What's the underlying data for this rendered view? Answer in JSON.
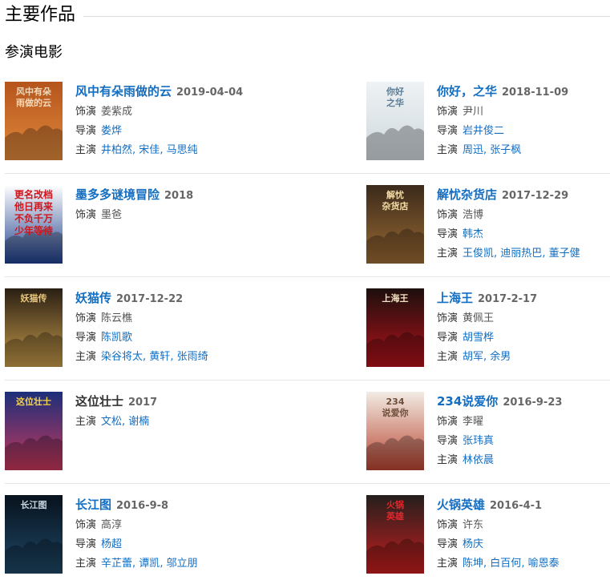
{
  "section": {
    "title": "主要作品"
  },
  "subsection": {
    "title": "参演电影"
  },
  "labels": {
    "role": "饰演",
    "director": "导演",
    "cast": "主演",
    "comma": ", "
  },
  "films": [
    {
      "title": "风中有朵雨做的云",
      "title_link": true,
      "date": "2019-04-04",
      "role": "姜紫成",
      "directors": [
        "娄烨"
      ],
      "cast": [
        "井柏然",
        "宋佳",
        "马思纯"
      ],
      "poster": {
        "bg": "#b5541c",
        "bg2": "#e08a3c",
        "text": "风中有朵\n雨做的云",
        "text_color": "#f3d9b8",
        "icon": "poster-rain-cloud-icon"
      }
    },
    {
      "title": "你好，之华",
      "title_link": true,
      "date": "2018-11-09",
      "role": "尹川",
      "directors": [
        "岩井俊二"
      ],
      "cast": [
        "周迅",
        "张子枫"
      ],
      "poster": {
        "bg": "#eef2f4",
        "bg2": "#cfd8de",
        "text": "你好\n之华",
        "text_color": "#5b7c95",
        "icon": "poster-cast-collage-icon"
      }
    },
    {
      "title": "墨多多谜境冒险",
      "title_link": true,
      "date": "2018",
      "role": "墨爸",
      "directors": [],
      "cast": [],
      "poster": {
        "bg": "#ffffff",
        "bg2": "#1e3f8c",
        "text": "更名改档\n他日再来\n不负千万\n少年等待",
        "text_color": "#d0161b",
        "icon": "poster-text-notice-icon"
      }
    },
    {
      "title": "解忧杂货店",
      "title_link": true,
      "date": "2017-12-29",
      "role": "浩博",
      "directors": [
        "韩杰"
      ],
      "cast": [
        "王俊凯",
        "迪丽热巴",
        "董子健"
      ],
      "poster": {
        "bg": "#3b2a1b",
        "bg2": "#9a6a34",
        "text": "解忧\n杂货店",
        "text_color": "#f2dca4",
        "icon": "poster-grocery-store-icon"
      }
    },
    {
      "title": "妖猫传",
      "title_link": true,
      "date": "2017-12-22",
      "role": "陈云樵",
      "directors": [
        "陈凯歌"
      ],
      "cast": [
        "染谷将太",
        "黄轩",
        "张雨绮"
      ],
      "poster": {
        "bg": "#2a1f14",
        "bg2": "#c49a4a",
        "text": "妖猫传",
        "text_color": "#e8c77a",
        "icon": "poster-cat-legend-icon"
      }
    },
    {
      "title": "上海王",
      "title_link": true,
      "date": "2017-2-17",
      "role": "黄佩王",
      "directors": [
        "胡雪桦"
      ],
      "cast": [
        "胡军",
        "余男"
      ],
      "poster": {
        "bg": "#1c0f0d",
        "bg2": "#b3121b",
        "text": "上海王",
        "text_color": "#f2e3c2",
        "icon": "poster-shanghai-king-icon"
      }
    },
    {
      "title": "这位壮士",
      "title_link": false,
      "date": "2017",
      "role": "",
      "directors": [],
      "cast": [
        "文松",
        "谢楠"
      ],
      "poster": {
        "bg": "#1c2f7a",
        "bg2": "#c8375a",
        "text": "这位壮士",
        "text_color": "#f6d44a",
        "icon": "poster-warrior-icon"
      }
    },
    {
      "title": "234说爱你",
      "title_link": true,
      "date": "2016-9-23",
      "role": "李曜",
      "directors": [
        "张玮真"
      ],
      "cast": [
        "林依晨"
      ],
      "poster": {
        "bg": "#f1ece4",
        "bg2": "#b9432f",
        "text": "234\n说爱你",
        "text_color": "#6d4e3a",
        "icon": "poster-couple-icon"
      }
    },
    {
      "title": "长江图",
      "title_link": true,
      "date": "2016-9-8",
      "role": "高淳",
      "directors": [
        "杨超"
      ],
      "cast": [
        "辛芷蕾",
        "谭凯",
        "邬立朋"
      ],
      "poster": {
        "bg": "#07121d",
        "bg2": "#1f4766",
        "text": "长江图",
        "text_color": "#c9d6e0",
        "icon": "poster-river-night-icon"
      }
    },
    {
      "title": "火锅英雄",
      "title_link": true,
      "date": "2016-4-1",
      "role": "许东",
      "directors": [
        "杨庆"
      ],
      "cast": [
        "陈坤",
        "白百何",
        "喻恩泰"
      ],
      "poster": {
        "bg": "#231f1d",
        "bg2": "#c81e1e",
        "text": "火锅\n英雄",
        "text_color": "#e3262b",
        "icon": "poster-hotpot-heroes-icon"
      }
    }
  ]
}
